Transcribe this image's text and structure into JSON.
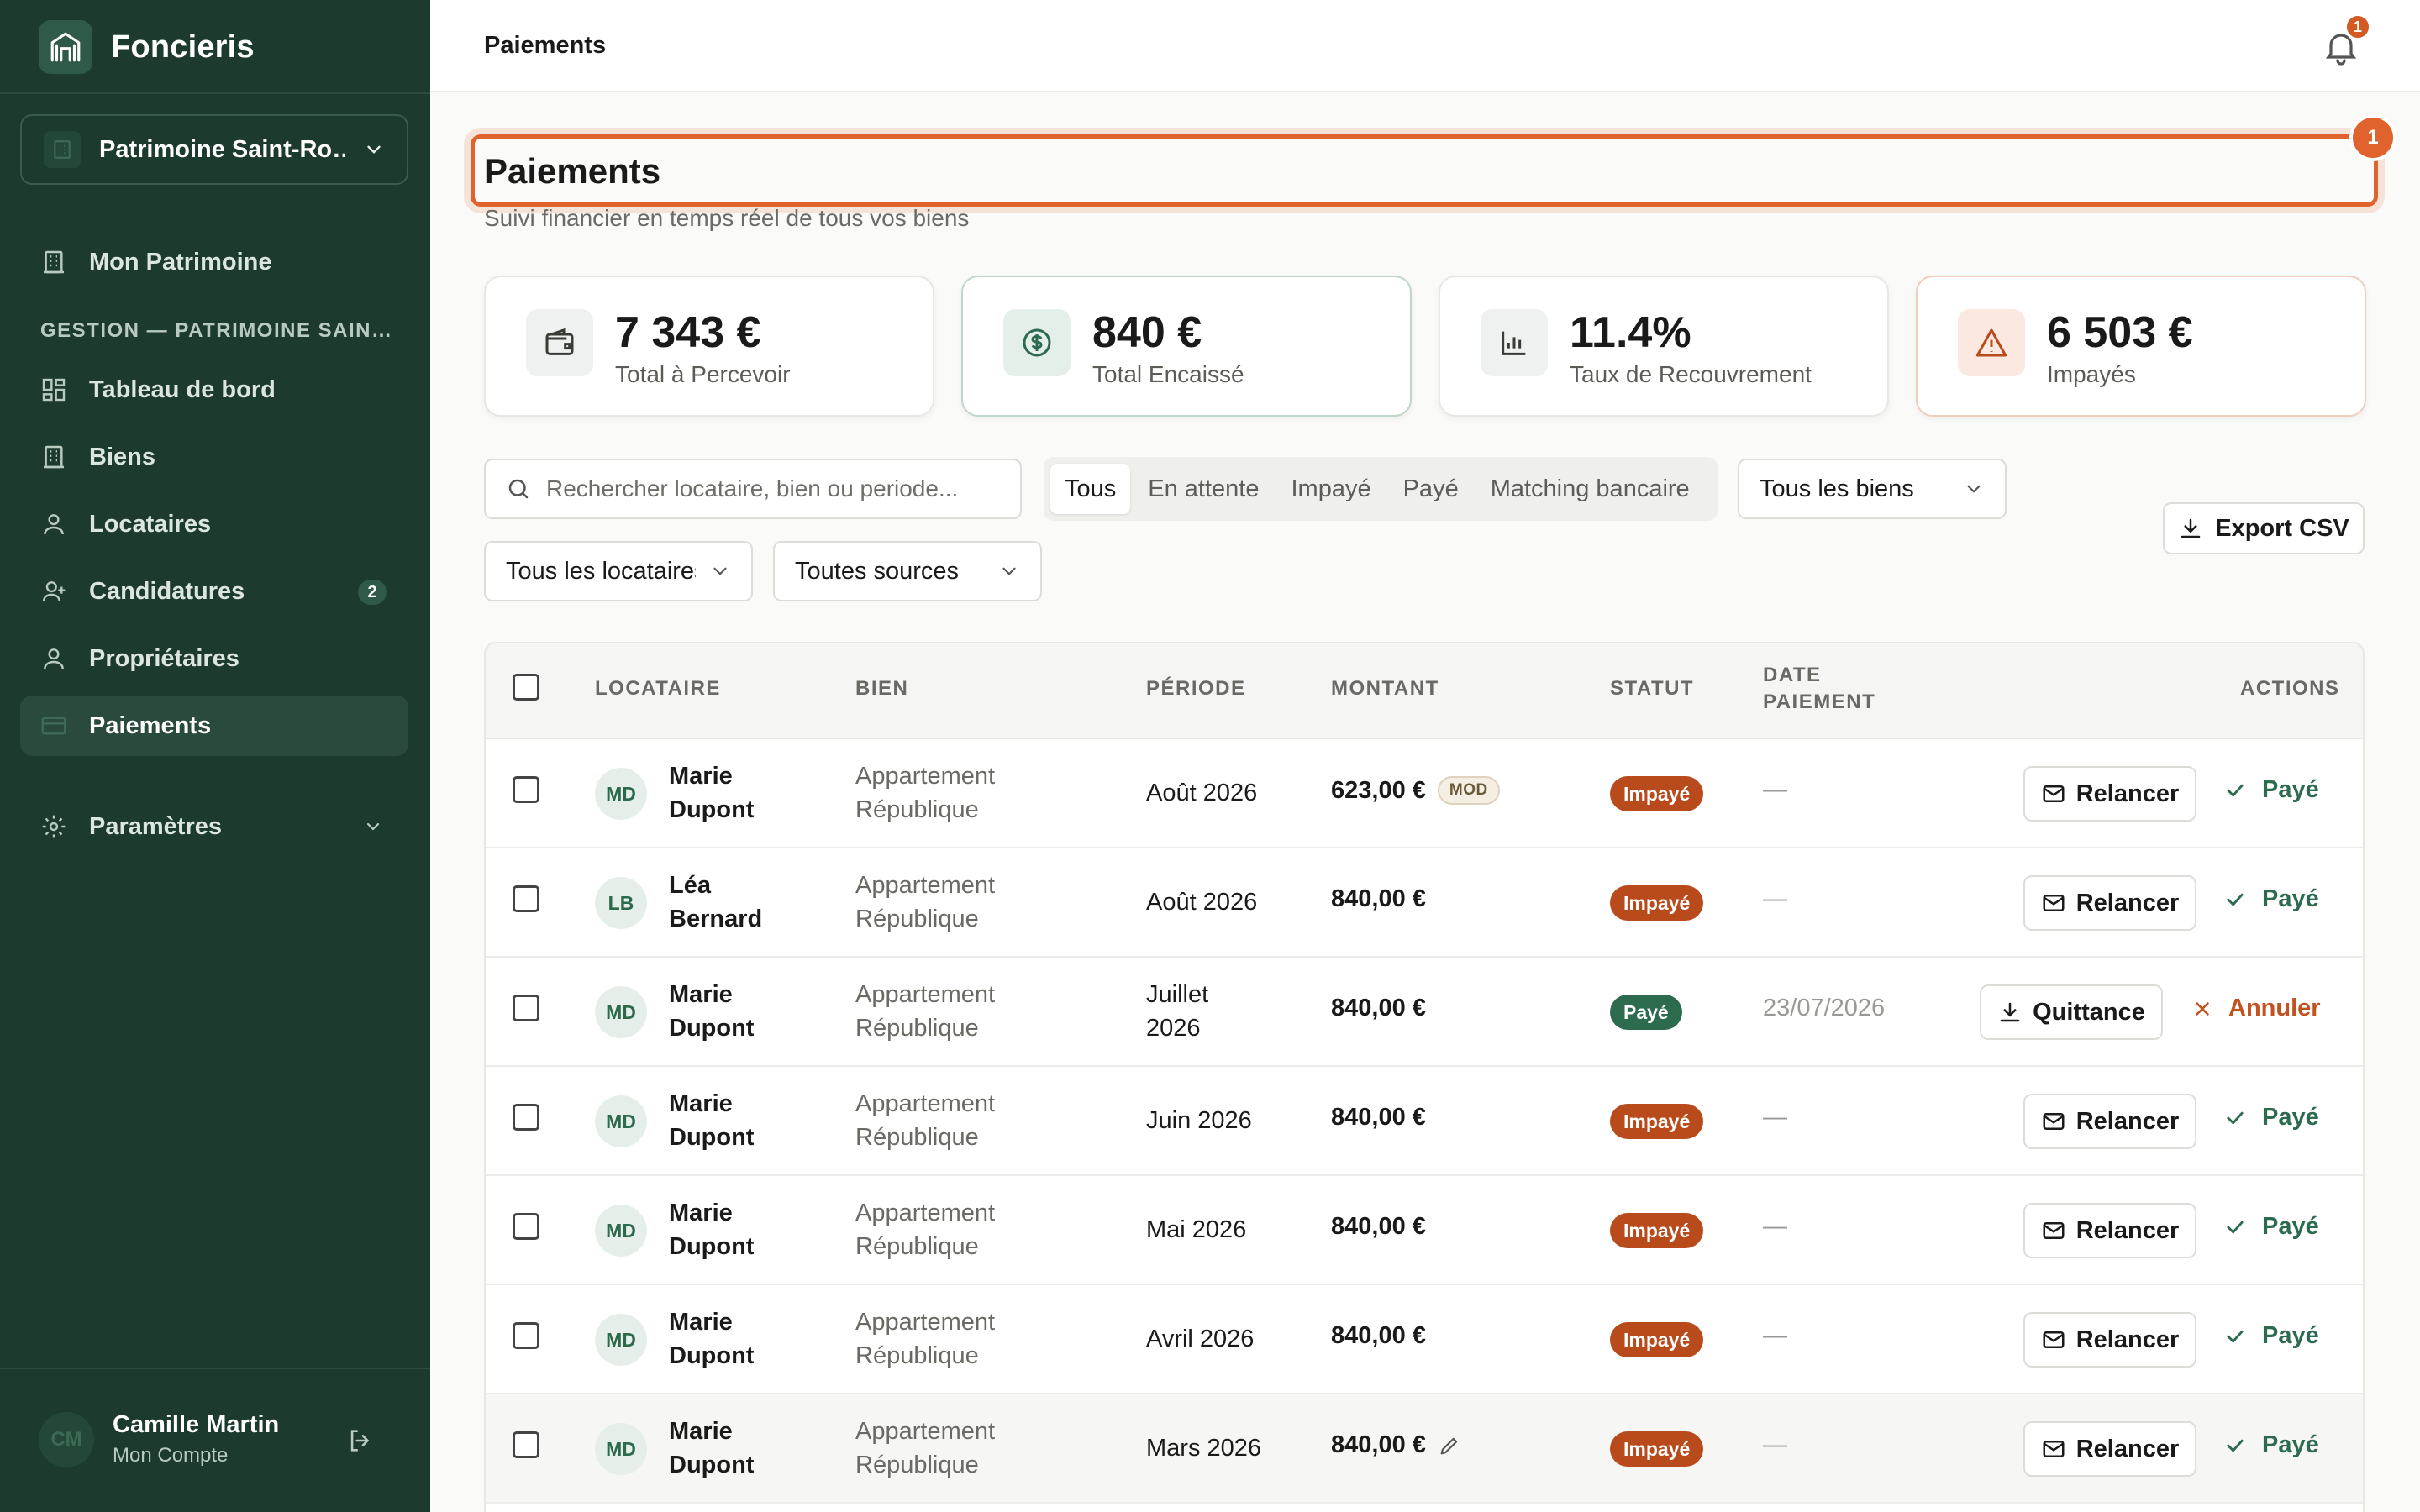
{
  "app": {
    "brand": "Foncieris",
    "org": "Patrimoine Saint-Ro…"
  },
  "sidebar": {
    "top_item": "Mon Patrimoine",
    "section": "GESTION — PATRIMOINE SAIN…",
    "items": [
      {
        "label": "Tableau de bord",
        "icon": "dashboard-icon"
      },
      {
        "label": "Biens",
        "icon": "building-icon"
      },
      {
        "label": "Locataires",
        "icon": "user-icon"
      },
      {
        "label": "Candidatures",
        "icon": "user-plus-icon",
        "badge": "2"
      },
      {
        "label": "Propriétaires",
        "icon": "user-icon"
      },
      {
        "label": "Paiements",
        "icon": "card-icon",
        "active": true
      }
    ],
    "settings": "Paramètres",
    "user": {
      "initials": "CM",
      "name": "Camille Martin",
      "sub": "Mon Compte"
    }
  },
  "topbar": {
    "title": "Paiements",
    "notification_count": "1"
  },
  "page": {
    "title": "Paiements",
    "title_badge": "1",
    "subtitle": "Suivi financier en temps réel de tous vos biens"
  },
  "kpis": [
    {
      "value": "7 343 €",
      "label": "Total à Percevoir",
      "icon": "wallet-icon"
    },
    {
      "value": "840 €",
      "label": "Total Encaissé",
      "icon": "dollar-circle-icon"
    },
    {
      "value": "11.4%",
      "label": "Taux de Recouvrement",
      "icon": "bar-chart-icon"
    },
    {
      "value": "6 503 €",
      "label": "Impayés",
      "icon": "warning-icon"
    }
  ],
  "filters": {
    "search_placeholder": "Rechercher locataire, bien ou periode...",
    "tabs": [
      "Tous",
      "En attente",
      "Impayé",
      "Payé",
      "Matching bancaire"
    ],
    "active_tab": "Tous",
    "property_select": "Tous les biens",
    "tenant_select": "Tous les locataires",
    "source_select": "Toutes sources",
    "export_label": "Export CSV"
  },
  "table": {
    "headers": {
      "tenant": "LOCATAIRE",
      "property": "BIEN",
      "period": "PÉRIODE",
      "amount": "MONTANT",
      "status": "STATUT",
      "date_l1": "DATE",
      "date_l2": "PAIEMENT",
      "actions": "ACTIONS"
    },
    "rows": [
      {
        "initials": "MD",
        "first": "Marie",
        "last": "Dupont",
        "bien1": "Appartement",
        "bien2": "République",
        "period": "Août 2026",
        "amount": "623,00 €",
        "tag": "MOD",
        "status": "Impayé",
        "date": "—",
        "action": "Relancer",
        "secondary": "Payé"
      },
      {
        "initials": "LB",
        "first": "Léa",
        "last": "Bernard",
        "bien1": "Appartement",
        "bien2": "République",
        "period": "Août 2026",
        "amount": "840,00 €",
        "status": "Impayé",
        "date": "—",
        "action": "Relancer",
        "secondary": "Payé"
      },
      {
        "initials": "MD",
        "first": "Marie",
        "last": "Dupont",
        "bien1": "Appartement",
        "bien2": "République",
        "period1": "Juillet",
        "period2": "2026",
        "amount": "840,00 €",
        "status": "Payé",
        "date": "23/07/2026",
        "action": "Quittance",
        "secondary": "Annuler"
      },
      {
        "initials": "MD",
        "first": "Marie",
        "last": "Dupont",
        "bien1": "Appartement",
        "bien2": "République",
        "period": "Juin 2026",
        "amount": "840,00 €",
        "status": "Impayé",
        "date": "—",
        "action": "Relancer",
        "secondary": "Payé"
      },
      {
        "initials": "MD",
        "first": "Marie",
        "last": "Dupont",
        "bien1": "Appartement",
        "bien2": "République",
        "period": "Mai 2026",
        "amount": "840,00 €",
        "status": "Impayé",
        "date": "—",
        "action": "Relancer",
        "secondary": "Payé"
      },
      {
        "initials": "MD",
        "first": "Marie",
        "last": "Dupont",
        "bien1": "Appartement",
        "bien2": "République",
        "period": "Avril 2026",
        "amount": "840,00 €",
        "status": "Impayé",
        "date": "—",
        "action": "Relancer",
        "secondary": "Payé"
      },
      {
        "initials": "MD",
        "first": "Marie",
        "last": "Dupont",
        "bien1": "Appartement",
        "bien2": "République",
        "period": "Mars 2026",
        "amount": "840,00 €",
        "status": "Impayé",
        "date": "—",
        "action": "Relancer",
        "secondary": "Payé"
      }
    ]
  },
  "colors": {
    "sidebar": "#1c3a2e",
    "accent_orange": "#e0622d",
    "unpaid": "#b84a1c",
    "paid": "#2c6b4d"
  }
}
